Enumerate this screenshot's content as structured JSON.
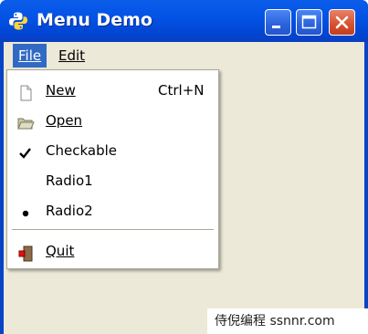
{
  "window": {
    "title": "Menu Demo"
  },
  "menubar": {
    "file_label": "File",
    "edit_label": "Edit"
  },
  "file_menu": {
    "new_label": "New",
    "new_shortcut": "Ctrl+N",
    "open_label": "Open",
    "checkable_label": "Checkable",
    "checkable_checked": true,
    "radio1_label": "Radio1",
    "radio1_selected": false,
    "radio2_label": "Radio2",
    "radio2_selected": true,
    "quit_label": "Quit"
  },
  "watermark": "侍倪编程 ssnnr.com",
  "colors": {
    "titlebar": "#0353e6",
    "menu_highlight": "#316ac5",
    "client_bg": "#ece9d8",
    "close_button": "#d6502d"
  }
}
